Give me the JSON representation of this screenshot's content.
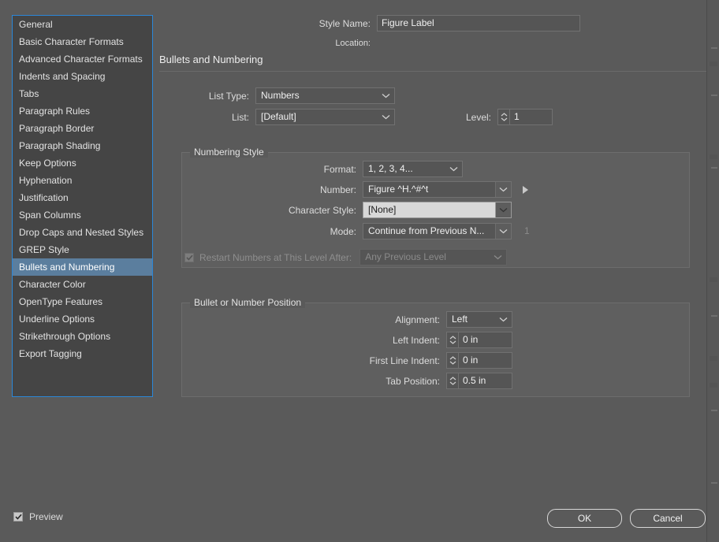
{
  "window": {
    "style_name_label": "Style Name:",
    "style_name_value": "Figure Label",
    "location_label": "Location:",
    "location_value": "",
    "section_title": "Bullets and Numbering"
  },
  "sidebar": {
    "items": [
      {
        "label": "General",
        "selected": false
      },
      {
        "label": "Basic Character Formats",
        "selected": false
      },
      {
        "label": "Advanced Character Formats",
        "selected": false
      },
      {
        "label": "Indents and Spacing",
        "selected": false
      },
      {
        "label": "Tabs",
        "selected": false
      },
      {
        "label": "Paragraph Rules",
        "selected": false
      },
      {
        "label": "Paragraph Border",
        "selected": false
      },
      {
        "label": "Paragraph Shading",
        "selected": false
      },
      {
        "label": "Keep Options",
        "selected": false
      },
      {
        "label": "Hyphenation",
        "selected": false
      },
      {
        "label": "Justification",
        "selected": false
      },
      {
        "label": "Span Columns",
        "selected": false
      },
      {
        "label": "Drop Caps and Nested Styles",
        "selected": false
      },
      {
        "label": "GREP Style",
        "selected": false
      },
      {
        "label": "Bullets and Numbering",
        "selected": true
      },
      {
        "label": "Character Color",
        "selected": false
      },
      {
        "label": "OpenType Features",
        "selected": false
      },
      {
        "label": "Underline Options",
        "selected": false
      },
      {
        "label": "Strikethrough Options",
        "selected": false
      },
      {
        "label": "Export Tagging",
        "selected": false
      }
    ]
  },
  "list_options": {
    "list_type_label": "List Type:",
    "list_type_value": "Numbers",
    "list_label": "List:",
    "list_value": "[Default]",
    "level_label": "Level:",
    "level_value": "1"
  },
  "numbering_style": {
    "title": "Numbering Style",
    "format_label": "Format:",
    "format_value": "1, 2, 3, 4...",
    "number_label": "Number:",
    "number_value": "Figure ^H.^#^t",
    "character_style_label": "Character Style:",
    "character_style_value": "[None]",
    "mode_label": "Mode:",
    "mode_value": "Continue from Previous N...",
    "mode_number_value": "1",
    "restart_label": "Restart Numbers at This Level After:",
    "restart_value": "Any Previous Level"
  },
  "position": {
    "title": "Bullet or Number Position",
    "alignment_label": "Alignment:",
    "alignment_value": "Left",
    "left_indent_label": "Left Indent:",
    "left_indent_value": "0 in",
    "first_line_indent_label": "First Line Indent:",
    "first_line_indent_value": "0 in",
    "tab_position_label": "Tab Position:",
    "tab_position_value": "0.5 in"
  },
  "footer": {
    "preview_label": "Preview",
    "ok_label": "OK",
    "cancel_label": "Cancel"
  },
  "colors": {
    "dialog_bg": "#5a5a5a",
    "panel_bg": "#5f5f5f",
    "focus_border": "#2b87d8",
    "selection": "#5b7e9e",
    "field_bg": "#555555",
    "light_field_bg": "#d8d8d8"
  }
}
